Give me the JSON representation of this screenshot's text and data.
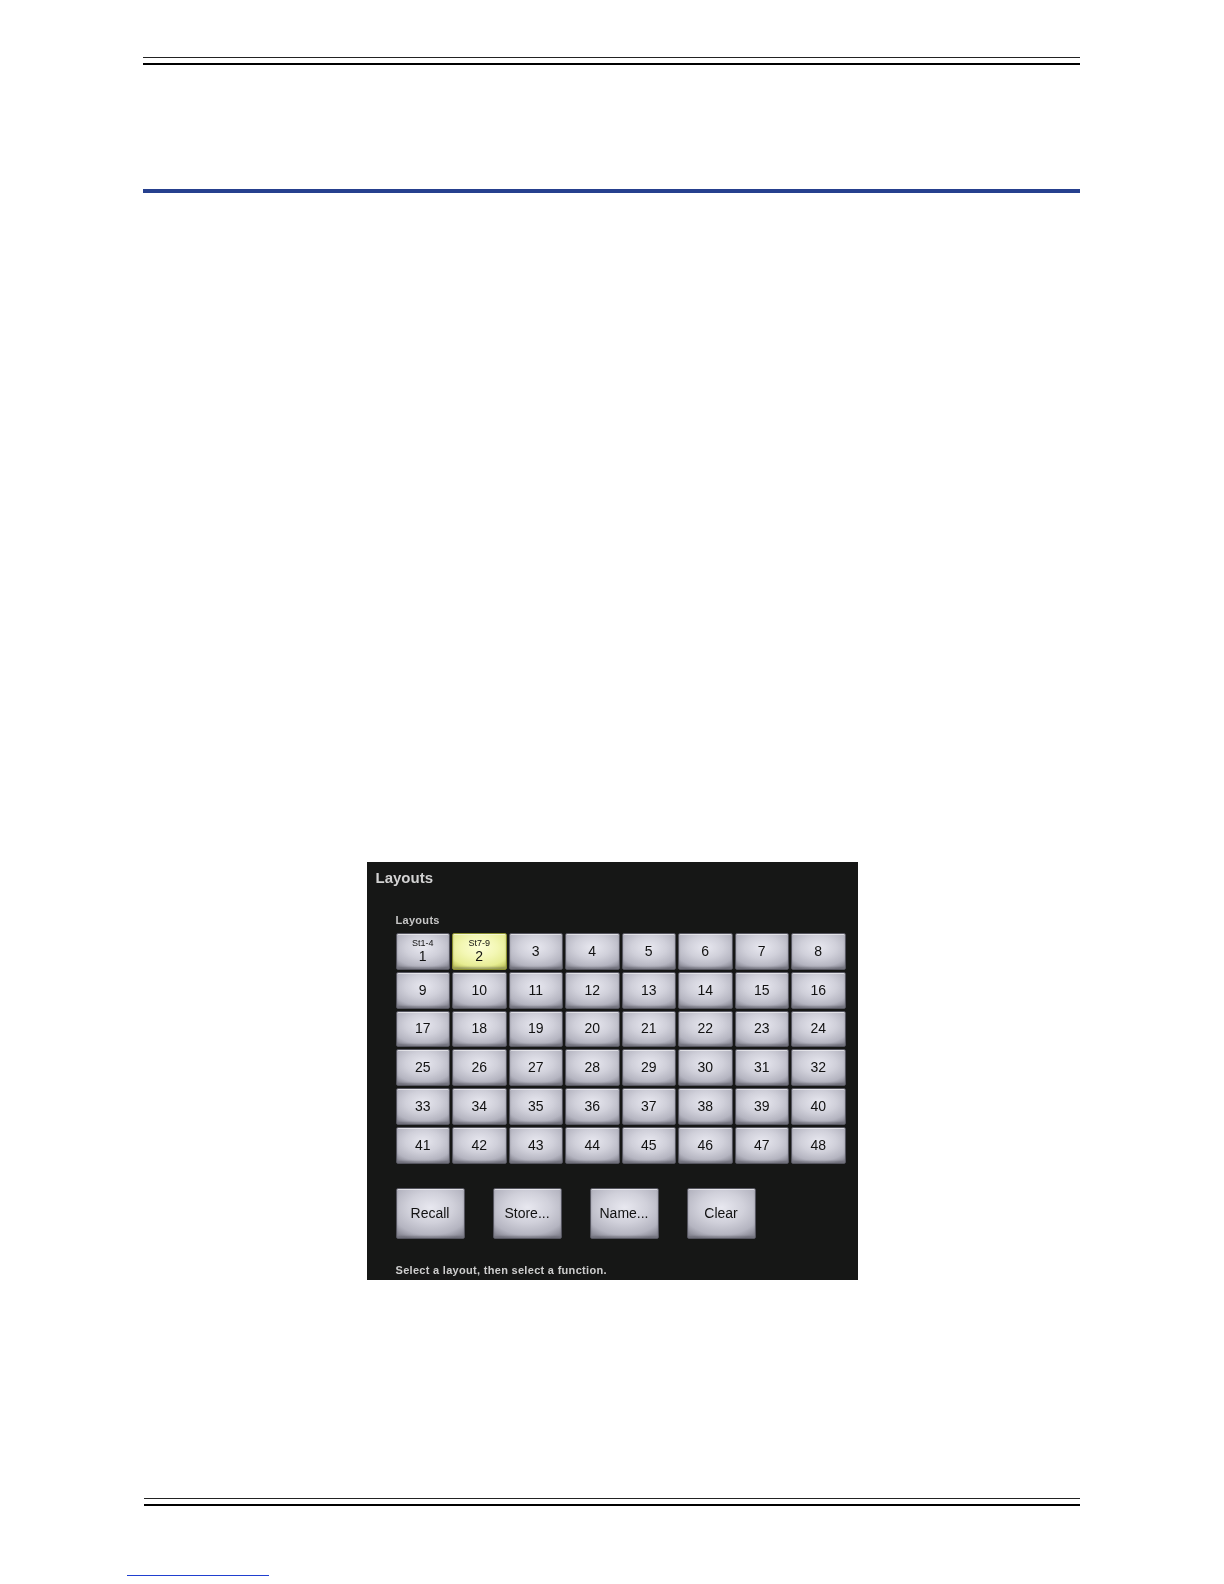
{
  "panel": {
    "title": "Layouts",
    "section_label": "Layouts",
    "layouts": [
      {
        "number": "1",
        "name": "St1-4",
        "selected": false
      },
      {
        "number": "2",
        "name": "St7-9",
        "selected": true
      },
      {
        "number": "3",
        "selected": false
      },
      {
        "number": "4",
        "selected": false
      },
      {
        "number": "5",
        "selected": false
      },
      {
        "number": "6",
        "selected": false
      },
      {
        "number": "7",
        "selected": false
      },
      {
        "number": "8",
        "selected": false
      },
      {
        "number": "9",
        "selected": false
      },
      {
        "number": "10",
        "selected": false
      },
      {
        "number": "11",
        "selected": false
      },
      {
        "number": "12",
        "selected": false
      },
      {
        "number": "13",
        "selected": false
      },
      {
        "number": "14",
        "selected": false
      },
      {
        "number": "15",
        "selected": false
      },
      {
        "number": "16",
        "selected": false
      },
      {
        "number": "17",
        "selected": false
      },
      {
        "number": "18",
        "selected": false
      },
      {
        "number": "19",
        "selected": false
      },
      {
        "number": "20",
        "selected": false
      },
      {
        "number": "21",
        "selected": false
      },
      {
        "number": "22",
        "selected": false
      },
      {
        "number": "23",
        "selected": false
      },
      {
        "number": "24",
        "selected": false
      },
      {
        "number": "25",
        "selected": false
      },
      {
        "number": "26",
        "selected": false
      },
      {
        "number": "27",
        "selected": false
      },
      {
        "number": "28",
        "selected": false
      },
      {
        "number": "29",
        "selected": false
      },
      {
        "number": "30",
        "selected": false
      },
      {
        "number": "31",
        "selected": false
      },
      {
        "number": "32",
        "selected": false
      },
      {
        "number": "33",
        "selected": false
      },
      {
        "number": "34",
        "selected": false
      },
      {
        "number": "35",
        "selected": false
      },
      {
        "number": "36",
        "selected": false
      },
      {
        "number": "37",
        "selected": false
      },
      {
        "number": "38",
        "selected": false
      },
      {
        "number": "39",
        "selected": false
      },
      {
        "number": "40",
        "selected": false
      },
      {
        "number": "41",
        "selected": false
      },
      {
        "number": "42",
        "selected": false
      },
      {
        "number": "43",
        "selected": false
      },
      {
        "number": "44",
        "selected": false
      },
      {
        "number": "45",
        "selected": false
      },
      {
        "number": "46",
        "selected": false
      },
      {
        "number": "47",
        "selected": false
      },
      {
        "number": "48",
        "selected": false
      }
    ],
    "functions": [
      "Recall",
      "Store...",
      "Name...",
      "Clear"
    ],
    "status": "Select a layout, then select a function."
  }
}
